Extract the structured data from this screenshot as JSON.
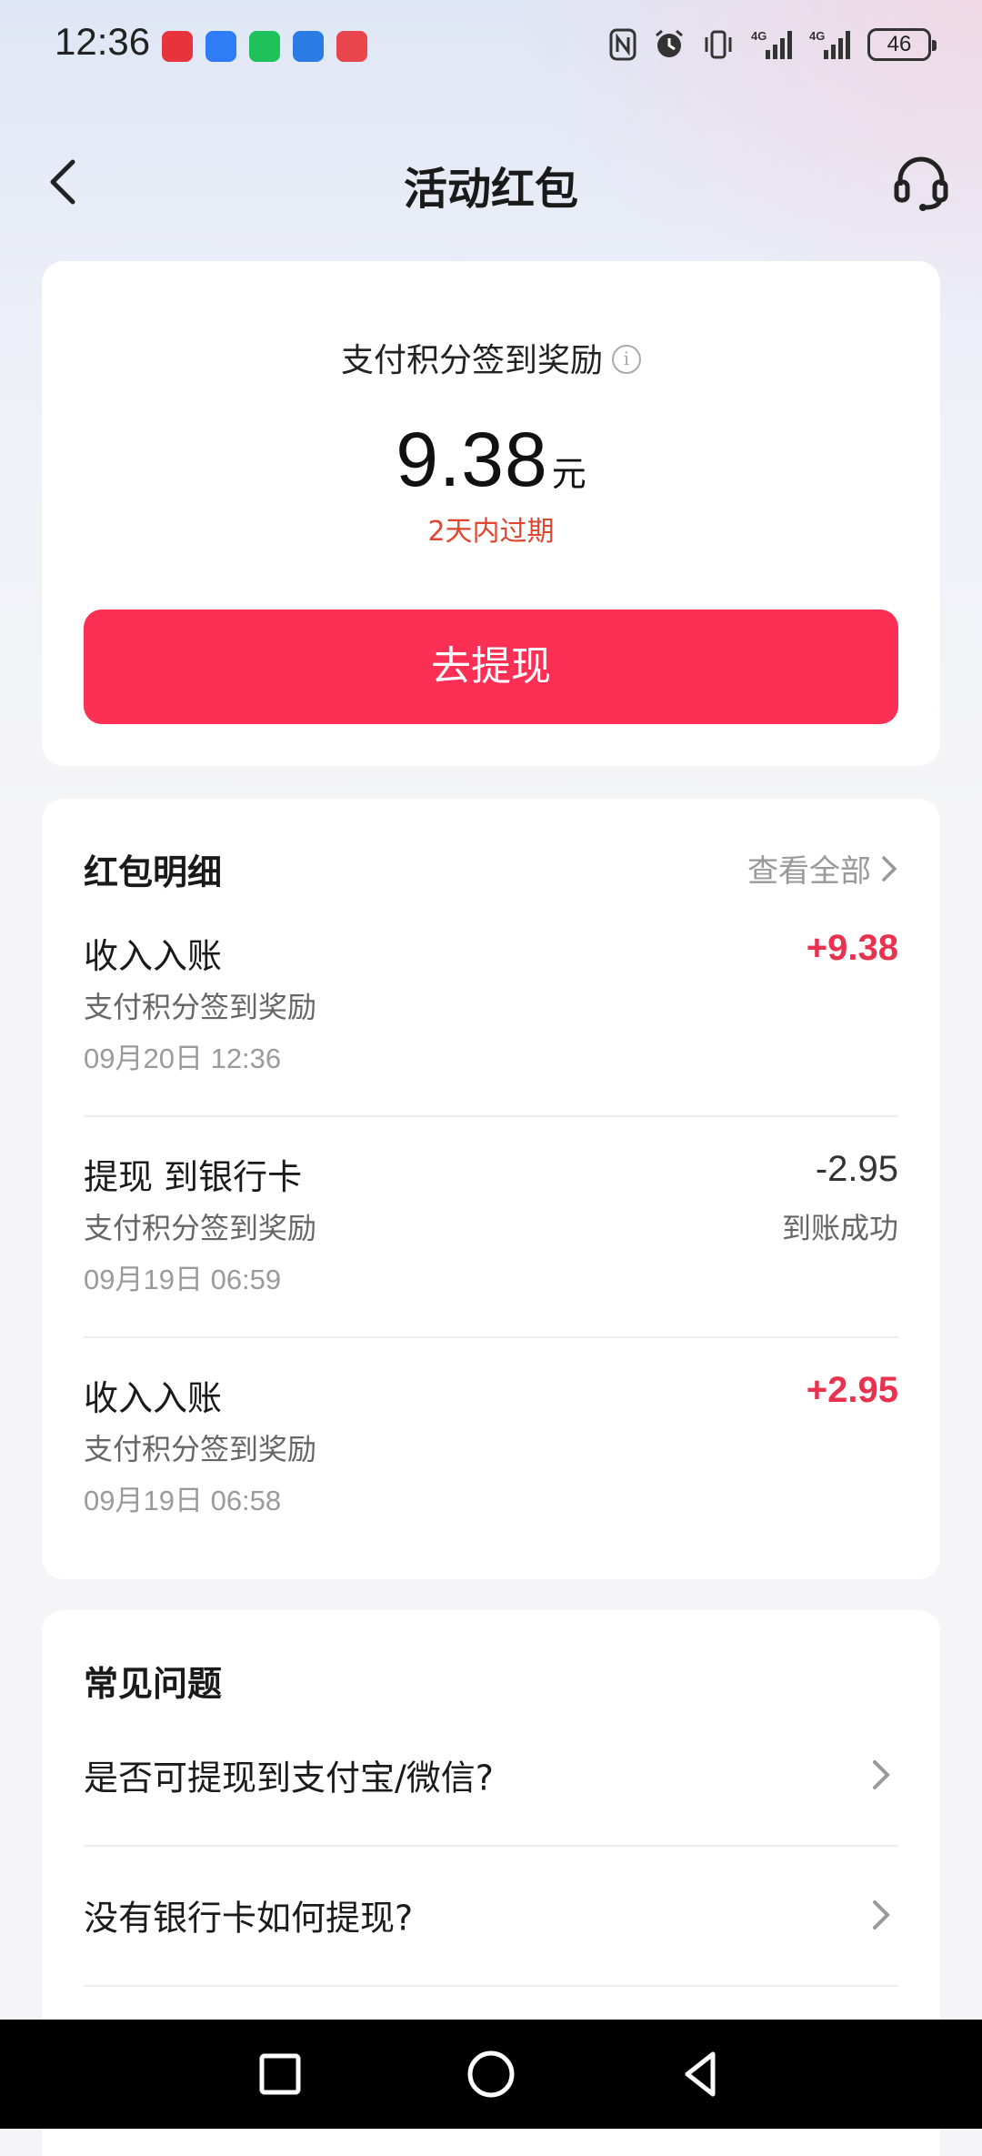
{
  "status_bar": {
    "time": "12:36",
    "battery": "46",
    "app_icons": [
      "huawei-app-icon",
      "shield-app-icon",
      "wechat-app-icon",
      "compass-app-icon",
      "book-app-icon"
    ],
    "system_icons": [
      "nfc-icon",
      "alarm-icon",
      "vibrate-icon",
      "signal-4g-icon",
      "signal-4g-icon"
    ]
  },
  "header": {
    "title": "活动红包",
    "back_icon": "chevron-left-icon",
    "service_icon": "headset-icon"
  },
  "reward": {
    "title": "支付积分签到奖励",
    "amount": "9.38",
    "unit": "元",
    "expiry": "2天内过期",
    "withdraw_label": "去提现",
    "accent_color": "#fd2f55"
  },
  "details": {
    "title": "红包明细",
    "view_all": "查看全部",
    "records": [
      {
        "title": "收入入账",
        "subtitle": "支付积分签到奖励",
        "date": "09月20日 12:36",
        "amount": "+9.38",
        "status": ""
      },
      {
        "title": "提现 到银行卡",
        "subtitle": "支付积分签到奖励",
        "date": "09月19日 06:59",
        "amount": "-2.95",
        "status": "到账成功"
      },
      {
        "title": "收入入账",
        "subtitle": "支付积分签到奖励",
        "date": "09月19日 06:58",
        "amount": "+2.95",
        "status": ""
      }
    ]
  },
  "faq": {
    "title": "常见问题",
    "items": [
      {
        "question": "是否可提现到支付宝/微信?"
      },
      {
        "question": "没有银行卡如何提现?"
      }
    ]
  },
  "nav_bar": {
    "recent_icon": "square-icon",
    "home_icon": "circle-icon",
    "back_icon": "triangle-back-icon"
  }
}
